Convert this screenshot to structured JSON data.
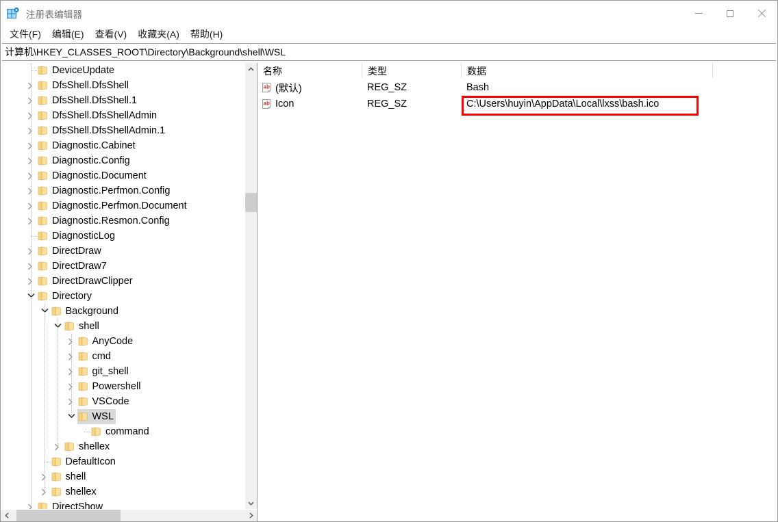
{
  "window": {
    "title": "注册表编辑器",
    "icon": "registry-editor-icon",
    "controls": {
      "minimize": "minimize-icon",
      "maximize": "maximize-icon",
      "close": "close-icon"
    }
  },
  "menubar": {
    "items": [
      {
        "label": "文件(F)"
      },
      {
        "label": "编辑(E)"
      },
      {
        "label": "查看(V)"
      },
      {
        "label": "收藏夹(A)"
      },
      {
        "label": "帮助(H)"
      }
    ]
  },
  "address": {
    "path": "计算机\\HKEY_CLASSES_ROOT\\Directory\\Background\\shell\\WSL"
  },
  "tree": {
    "nodes": [
      {
        "label": "DeviceUpdate",
        "depth": 1,
        "state": "leaf"
      },
      {
        "label": "DfsShell.DfsShell",
        "depth": 1,
        "state": "collapsed"
      },
      {
        "label": "DfsShell.DfsShell.1",
        "depth": 1,
        "state": "collapsed"
      },
      {
        "label": "DfsShell.DfsShellAdmin",
        "depth": 1,
        "state": "collapsed"
      },
      {
        "label": "DfsShell.DfsShellAdmin.1",
        "depth": 1,
        "state": "collapsed"
      },
      {
        "label": "Diagnostic.Cabinet",
        "depth": 1,
        "state": "collapsed"
      },
      {
        "label": "Diagnostic.Config",
        "depth": 1,
        "state": "collapsed"
      },
      {
        "label": "Diagnostic.Document",
        "depth": 1,
        "state": "collapsed"
      },
      {
        "label": "Diagnostic.Perfmon.Config",
        "depth": 1,
        "state": "collapsed"
      },
      {
        "label": "Diagnostic.Perfmon.Document",
        "depth": 1,
        "state": "collapsed"
      },
      {
        "label": "Diagnostic.Resmon.Config",
        "depth": 1,
        "state": "collapsed"
      },
      {
        "label": "DiagnosticLog",
        "depth": 1,
        "state": "leaf"
      },
      {
        "label": "DirectDraw",
        "depth": 1,
        "state": "collapsed"
      },
      {
        "label": "DirectDraw7",
        "depth": 1,
        "state": "collapsed"
      },
      {
        "label": "DirectDrawClipper",
        "depth": 1,
        "state": "collapsed"
      },
      {
        "label": "Directory",
        "depth": 1,
        "state": "expanded"
      },
      {
        "label": "Background",
        "depth": 2,
        "state": "expanded"
      },
      {
        "label": "shell",
        "depth": 3,
        "state": "expanded"
      },
      {
        "label": "AnyCode",
        "depth": 4,
        "state": "collapsed"
      },
      {
        "label": "cmd",
        "depth": 4,
        "state": "collapsed"
      },
      {
        "label": "git_shell",
        "depth": 4,
        "state": "collapsed"
      },
      {
        "label": "Powershell",
        "depth": 4,
        "state": "collapsed"
      },
      {
        "label": "VSCode",
        "depth": 4,
        "state": "collapsed"
      },
      {
        "label": "WSL",
        "depth": 4,
        "state": "expanded",
        "selected": true
      },
      {
        "label": "command",
        "depth": 5,
        "state": "leaf"
      },
      {
        "label": "shellex",
        "depth": 3,
        "state": "collapsed"
      },
      {
        "label": "DefaultIcon",
        "depth": 2,
        "state": "leaf"
      },
      {
        "label": "shell",
        "depth": 2,
        "state": "collapsed"
      },
      {
        "label": "shellex",
        "depth": 2,
        "state": "collapsed"
      },
      {
        "label": "DirectShow",
        "depth": 1,
        "state": "collapsed"
      }
    ],
    "scrollbars": {
      "vertical_up": "chevron-up-icon",
      "vertical_down": "chevron-down-icon",
      "horizontal_left": "chevron-left-icon",
      "horizontal_right": "chevron-right-icon"
    }
  },
  "values": {
    "columns": [
      {
        "label": "名称"
      },
      {
        "label": "类型"
      },
      {
        "label": "数据"
      }
    ],
    "rows": [
      {
        "icon": "string-value-icon",
        "name": "(默认)",
        "type": "REG_SZ",
        "data": "Bash",
        "highlighted": false
      },
      {
        "icon": "string-value-icon",
        "name": "Icon",
        "type": "REG_SZ",
        "data": "C:\\Users\\huyin\\AppData\\Local\\lxss\\bash.ico",
        "highlighted": true
      }
    ]
  },
  "colors": {
    "highlight_border": "#ff0000",
    "selection": "#d8d8d8",
    "folder": "#fbd67d",
    "title_text": "#6f6f6f"
  }
}
